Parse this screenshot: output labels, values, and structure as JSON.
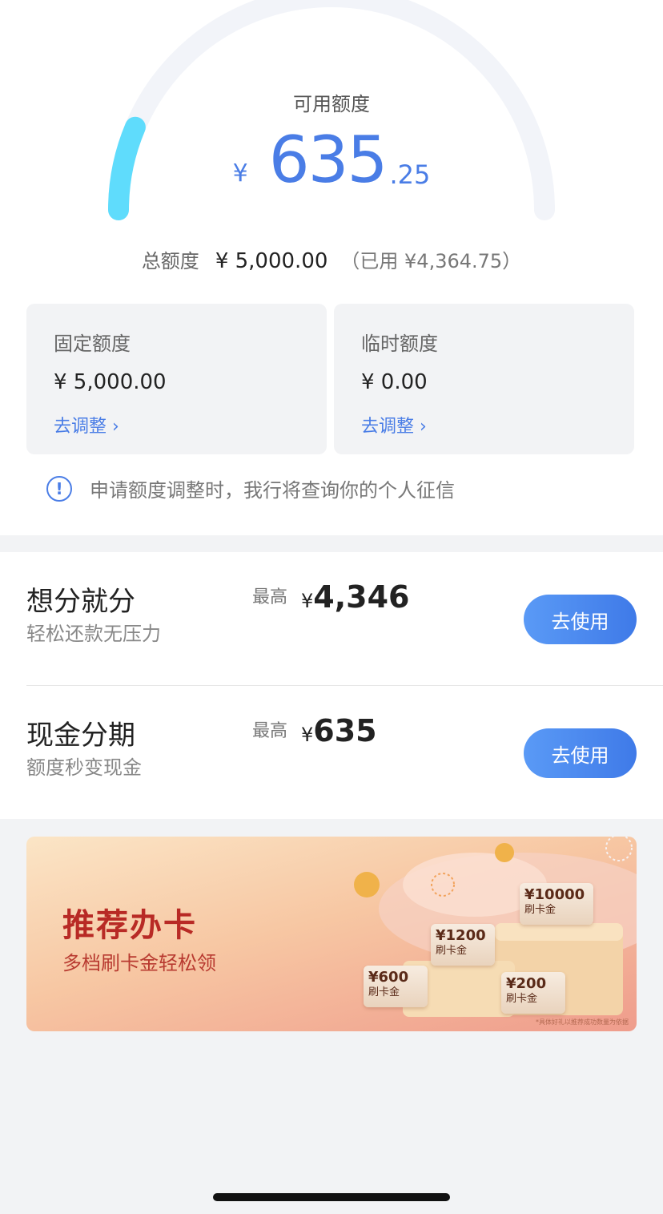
{
  "gauge": {
    "label": "可用额度",
    "currency": "¥",
    "amount_int": "635",
    "amount_dec": ".25",
    "fraction_available": 0.127,
    "track_color": "#f2f4f9",
    "fill_color": "#5fdcfc"
  },
  "total": {
    "label": "总额度",
    "value": "¥ 5,000.00",
    "used": "（已用 ¥4,364.75）"
  },
  "cards": [
    {
      "title": "固定额度",
      "value": "¥ 5,000.00",
      "link": "去调整 ›"
    },
    {
      "title": "临时额度",
      "value": "¥ 0.00",
      "link": "去调整 ›"
    }
  ],
  "notice": {
    "icon": "info-icon",
    "text": "申请额度调整时，我行将查询你的个人征信"
  },
  "products": [
    {
      "title": "想分就分",
      "subtitle": "轻松还款无压力",
      "max_label": "最高",
      "currency": "¥",
      "amount": "4,346",
      "button": "去使用"
    },
    {
      "title": "现金分期",
      "subtitle": "额度秒变现金",
      "max_label": "最高",
      "currency": "¥",
      "amount": "635",
      "button": "去使用"
    }
  ],
  "banner": {
    "title": "推荐办卡",
    "subtitle": "多档刷卡金轻松领",
    "tickets": [
      {
        "amount": "¥10000",
        "label": "刷卡金"
      },
      {
        "amount": "¥1200",
        "label": "刷卡金"
      },
      {
        "amount": "¥600",
        "label": "刷卡金"
      },
      {
        "amount": "¥200",
        "label": "刷卡金"
      }
    ],
    "note": "*具体好礼以推荐成功数量为依据"
  },
  "colors": {
    "accent": "#4a7de6",
    "button": "#4a86ee",
    "banner_title": "#b82a25"
  }
}
